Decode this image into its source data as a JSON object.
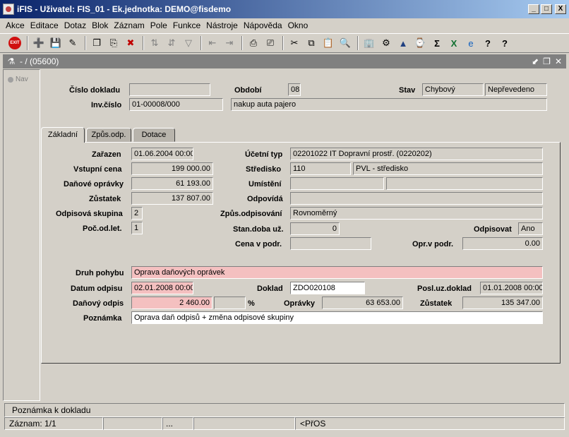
{
  "window": {
    "title": "iFIS - Uživatel: FIS_01 - Ek.jednotka: DEMO@fisdemo",
    "minimize": "_",
    "maximize": "□",
    "close": "X"
  },
  "menu": [
    "Akce",
    "Editace",
    "Dotaz",
    "Blok",
    "Záznam",
    "Pole",
    "Funkce",
    "Nástroje",
    "Nápověda",
    "Okno"
  ],
  "toolbar": {
    "exit_label": "EXIT",
    "icons": [
      "add-record-icon",
      "save-record-icon",
      "clear-icon",
      "duplicate-icon",
      "copy-icon",
      "delete-record-icon",
      "sort-asc-icon",
      "sort-desc-icon",
      "filter-icon",
      "previous-icon",
      "next-icon",
      "print-icon",
      "print-preview-icon",
      "cut-icon",
      "copy-text-icon",
      "paste-icon",
      "zoom-icon",
      "tools-icon",
      "help-icon",
      "settings-icon",
      "calculator-icon",
      "sum-icon",
      "excel-icon",
      "browser-icon",
      "about-icon",
      "info-icon"
    ]
  },
  "inner_window": {
    "title": "- / (05600)"
  },
  "nav": {
    "label": "Nav"
  },
  "header": {
    "cislo_dokladu_label": "Číslo dokladu",
    "cislo_dokladu_value": "",
    "obdobi_label": "Období",
    "obdobi_value": "08",
    "stav_label": "Stav",
    "stav_value1": "Chybový",
    "stav_value2": "Nepřevedeno",
    "inv_cislo_label": "Inv.číslo",
    "inv_cislo_value": "01-00008/000",
    "inv_popis_value": "nakup auta pajero"
  },
  "tabs": [
    {
      "label": "Základní",
      "active": true
    },
    {
      "label": "Způs.odp.",
      "active": false
    },
    {
      "label": "Dotace",
      "active": false
    }
  ],
  "basic": {
    "zarazen_label": "Zařazen",
    "zarazen_value": "01.06.2004 00:00",
    "ucetni_typ_label": "Účetní typ",
    "ucetni_typ_value": "02201022 IT Dopravní prostř. (0220202)",
    "vstupni_cena_label": "Vstupní cena",
    "vstupni_cena_value": "199 000.00",
    "stredisko_label": "Středisko",
    "stredisko_code": "110",
    "stredisko_name": "PVL - středisko",
    "danove_opravky_label": "Daňové oprávky",
    "danove_opravky_value": "61 193.00",
    "umisteni_label": "Umístění",
    "umisteni_value1": "",
    "umisteni_value2": "",
    "zustatek_label": "Zůstatek",
    "zustatek_value": "137 807.00",
    "odpovida_label": "Odpovídá",
    "odpovida_value": "",
    "odpisova_skupina_label": "Odpisová skupina",
    "odpisova_skupina_value": "2",
    "zpus_odpisovani_label": "Způs.odpisování",
    "zpus_odpisovani_value": "Rovnoměrný",
    "poc_od_let_label": "Poč.od.let.",
    "poc_od_let_value": "1",
    "stan_doba_label": "Stan.doba už.",
    "stan_doba_value": "0",
    "odpisovat_label": "Odpisovat",
    "odpisovat_value": "Ano",
    "cena_v_podr_label": "Cena v podr.",
    "cena_v_podr_value": "",
    "opr_v_podr_label": "Opr.v podr.",
    "opr_v_podr_value": "0.00"
  },
  "movement": {
    "druh_pohybu_label": "Druh pohybu",
    "druh_pohybu_value": "Oprava daňových oprávek",
    "datum_odpisu_label": "Datum odpisu",
    "datum_odpisu_value": "02.01.2008 00:00",
    "doklad_label": "Doklad",
    "doklad_value": "ZDO020108",
    "posl_uz_doklad_label": "Posl.uz.doklad",
    "posl_uz_doklad_value": "01.01.2008 00:00",
    "danovy_odpis_label": "Daňový odpis",
    "danovy_odpis_value": "2 460.00",
    "procento_value": "",
    "procento_label": "%",
    "opravky_label": "Oprávky",
    "opravky_value": "63 653.00",
    "zustatek_label": "Zůstatek",
    "zustatek_value": "135 347.00",
    "poznamka_label": "Poznámka",
    "poznamka_value": "Oprava daň odpisů + změna odpisové skupiny"
  },
  "status": {
    "hint": "Poznámka k dokladu",
    "record": "Záznam: 1/1",
    "ellipsis": "...",
    "mode": "<PřOS"
  }
}
